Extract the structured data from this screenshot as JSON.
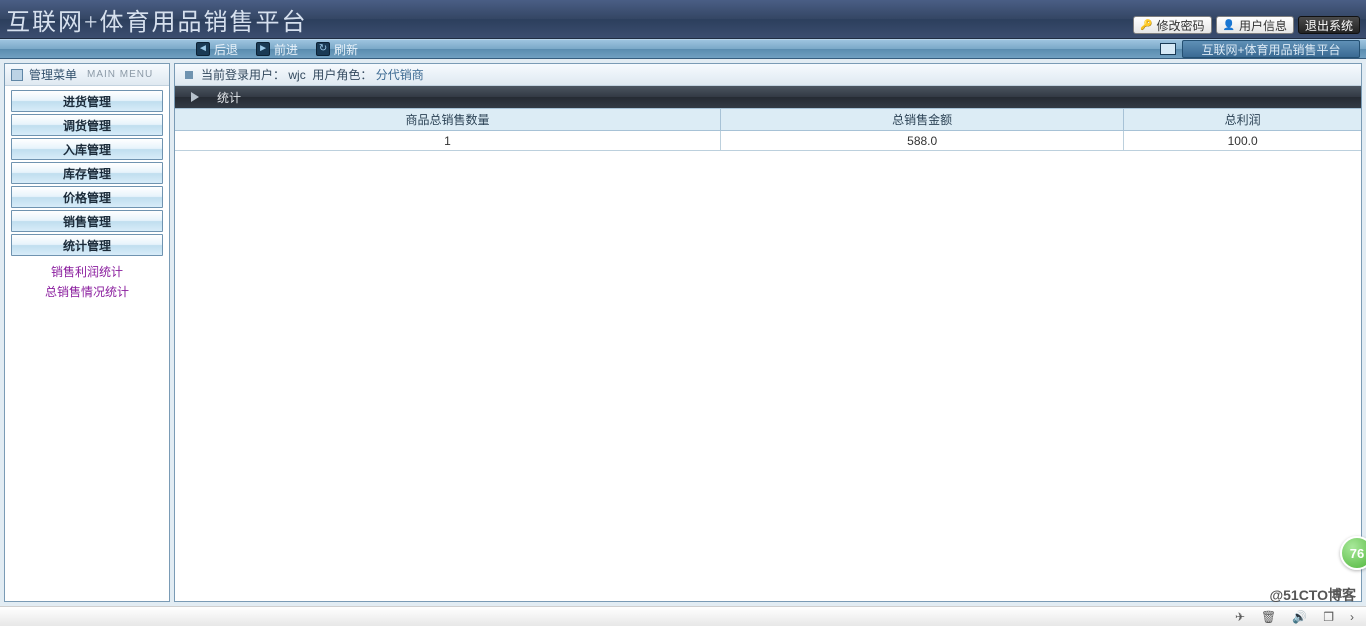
{
  "title": "互联网+体育用品销售平台",
  "header_buttons": {
    "change_password": "修改密码",
    "user_info": "用户信息",
    "logout": "退出系统"
  },
  "toolbar": {
    "back": "后退",
    "forward": "前进",
    "refresh": "刷新",
    "tab_name": "互联网+体育用品销售平台"
  },
  "sidebar": {
    "title": "管理菜单",
    "subtitle": "MAIN MENU",
    "items": [
      "进货管理",
      "调货管理",
      "入库管理",
      "库存管理",
      "价格管理",
      "销售管理",
      "统计管理"
    ],
    "sub_links": [
      "销售利润统计",
      "总销售情况统计"
    ]
  },
  "main": {
    "login_prefix": "当前登录用户：",
    "username": "wjc",
    "role_prefix": "用户角色：",
    "role": "分代销商",
    "section_title": "统计",
    "table": {
      "headers": [
        "商品总销售数量",
        "总销售金额",
        "总利润"
      ],
      "rows": [
        [
          "1",
          "588.0",
          "100.0"
        ]
      ]
    }
  },
  "badge": "76",
  "watermark": "@51CTO博客"
}
